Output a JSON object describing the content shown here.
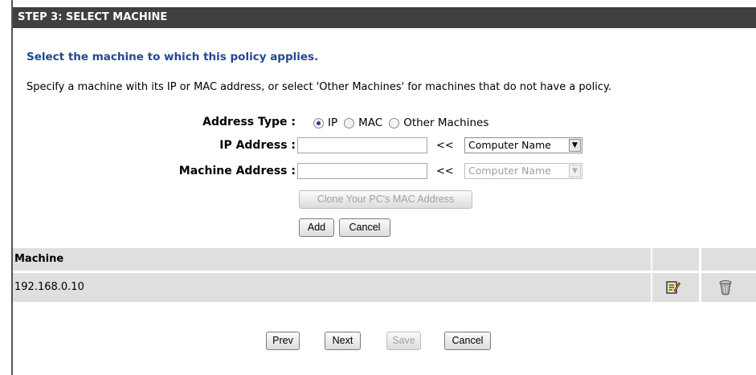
{
  "header": {
    "title": "STEP 3: SELECT MACHINE"
  },
  "subtitle": "Select the machine to which this policy applies.",
  "description": "Specify a machine with its IP or MAC address, or select 'Other Machines' for machines that do not have a policy.",
  "form": {
    "address_type_label": "Address Type :",
    "address_type_options": [
      "IP",
      "MAC",
      "Other Machines"
    ],
    "address_type_selected": "IP",
    "ip_label": "IP Address :",
    "ip_value": "",
    "ip_arrow": "<<",
    "ip_select": "Computer Name",
    "machine_label": "Machine Address :",
    "machine_value": "",
    "machine_arrow": "<<",
    "machine_select": "Computer Name",
    "clone_button": "Clone Your PC's MAC Address",
    "add_button": "Add",
    "cancel_button": "Cancel"
  },
  "table": {
    "header": "Machine",
    "rows": [
      {
        "machine": "192.168.0.10"
      }
    ]
  },
  "footer": {
    "prev": "Prev",
    "next": "Next",
    "save": "Save",
    "cancel": "Cancel"
  },
  "icons": {
    "edit": "edit-icon",
    "delete": "trash-icon"
  }
}
